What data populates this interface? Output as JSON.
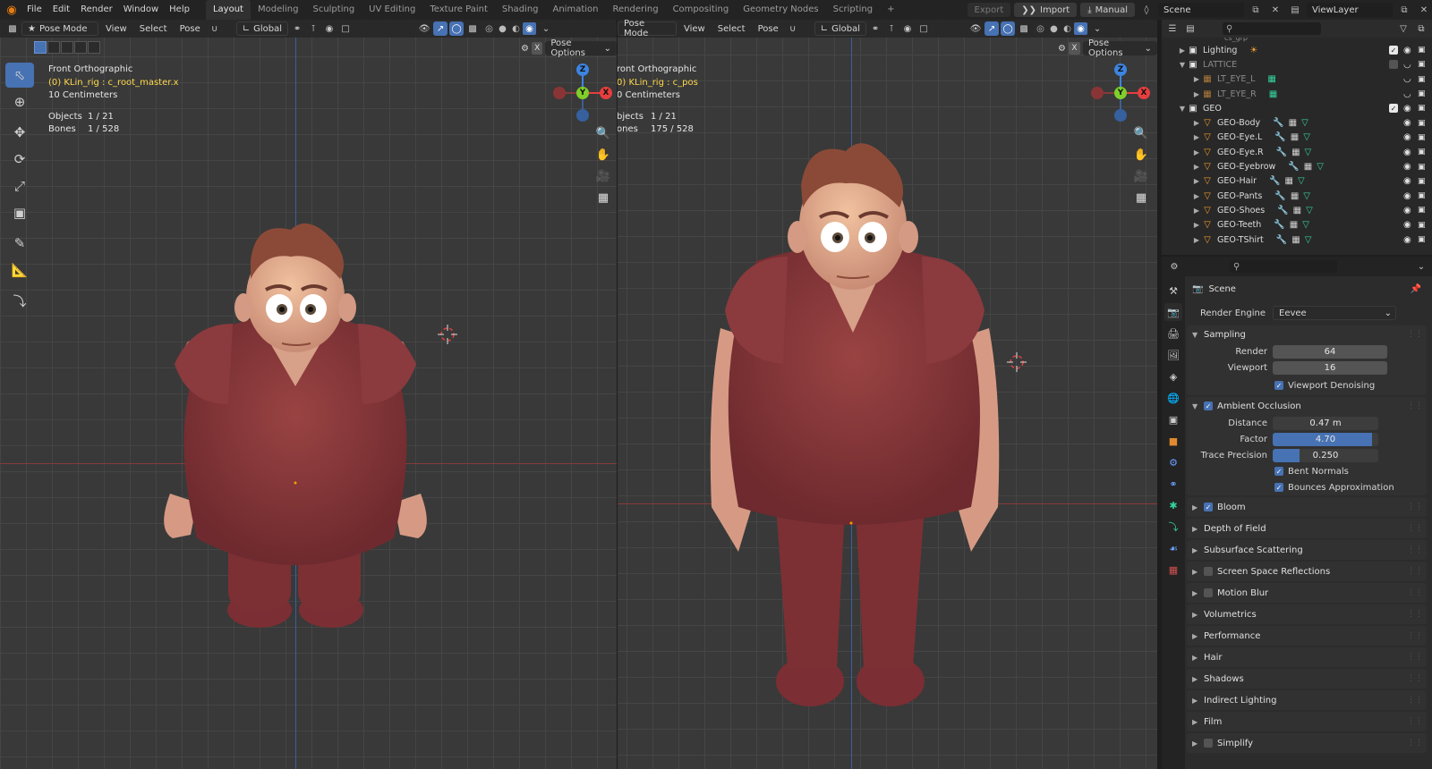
{
  "topbar": {
    "menus": [
      "File",
      "Edit",
      "Render",
      "Window",
      "Help"
    ],
    "workspaces": [
      "Layout",
      "Modeling",
      "Sculpting",
      "UV Editing",
      "Texture Paint",
      "Shading",
      "Animation",
      "Rendering",
      "Compositing",
      "Geometry Nodes",
      "Scripting"
    ],
    "active_workspace": "Layout",
    "export_label": "Export",
    "import_label": "Import",
    "manual_label": "Manual",
    "scene_name": "Scene",
    "view_layer": "ViewLayer"
  },
  "viewport_left": {
    "mode": "Pose Mode",
    "menus": [
      "View",
      "Select",
      "Pose"
    ],
    "orientation": "Global",
    "pose_options": "Pose Options",
    "view_name": "Front Orthographic",
    "active": "(0) KLin_rig : c_root_master.x",
    "scale": "10 Centimeters",
    "objects_label": "Objects",
    "objects_value": "1 / 21",
    "bones_label": "Bones",
    "bones_value": "1 / 528"
  },
  "viewport_right": {
    "mode": "Pose Mode",
    "menus": [
      "View",
      "Select",
      "Pose"
    ],
    "orientation": "Global",
    "pose_options": "Pose Options",
    "view_name": "ront Orthographic",
    "active": "0) KLin_rig : c_pos",
    "scale": "0 Centimeters",
    "objects_label": "bjects",
    "objects_value": "1 / 21",
    "bones_label": "ones",
    "bones_value": "175 / 528"
  },
  "gizmo": {
    "z": "Z",
    "y": "Y",
    "x": "X",
    "x_color": "#e63e3e",
    "y_color": "#7fcf2a",
    "z_color": "#3c84e0"
  },
  "outliner": {
    "top_partial": "cs_grp",
    "items": [
      {
        "name": "Lighting",
        "kind": "collection"
      },
      {
        "name": "LATTICE",
        "kind": "collection",
        "dim": true
      },
      {
        "name": "LT_EYE_L",
        "kind": "lattice",
        "dim": true
      },
      {
        "name": "LT_EYE_R",
        "kind": "lattice",
        "dim": true
      },
      {
        "name": "GEO",
        "kind": "collection"
      },
      {
        "name": "GEO-Body",
        "kind": "mesh"
      },
      {
        "name": "GEO-Eye.L",
        "kind": "mesh"
      },
      {
        "name": "GEO-Eye.R",
        "kind": "mesh"
      },
      {
        "name": "GEO-Eyebrow",
        "kind": "mesh"
      },
      {
        "name": "GEO-Hair",
        "kind": "mesh"
      },
      {
        "name": "GEO-Pants",
        "kind": "mesh"
      },
      {
        "name": "GEO-Shoes",
        "kind": "mesh"
      },
      {
        "name": "GEO-Teeth",
        "kind": "mesh"
      },
      {
        "name": "GEO-TShirt",
        "kind": "mesh"
      }
    ]
  },
  "properties": {
    "scene_title": "Scene",
    "render_engine_label": "Render Engine",
    "render_engine": "Eevee",
    "sampling": {
      "title": "Sampling",
      "render_label": "Render",
      "render": "64",
      "viewport_label": "Viewport",
      "viewport": "16",
      "denoise_label": "Viewport Denoising"
    },
    "ao": {
      "title": "Ambient Occlusion",
      "distance_label": "Distance",
      "distance": "0.47 m",
      "factor_label": "Factor",
      "factor": "4.70",
      "factor_fill": 0.94,
      "trace_label": "Trace Precision",
      "trace": "0.250",
      "trace_fill": 0.25,
      "bent_label": "Bent Normals",
      "bounces_label": "Bounces Approximation"
    },
    "panels": [
      {
        "name": "Bloom",
        "checkbox": "on"
      },
      {
        "name": "Depth of Field"
      },
      {
        "name": "Subsurface Scattering"
      },
      {
        "name": "Screen Space Reflections",
        "checkbox": "off"
      },
      {
        "name": "Motion Blur",
        "checkbox": "off"
      },
      {
        "name": "Volumetrics"
      },
      {
        "name": "Performance"
      },
      {
        "name": "Hair"
      },
      {
        "name": "Shadows"
      },
      {
        "name": "Indirect Lighting"
      },
      {
        "name": "Film"
      },
      {
        "name": "Simplify",
        "checkbox": "off"
      }
    ]
  }
}
